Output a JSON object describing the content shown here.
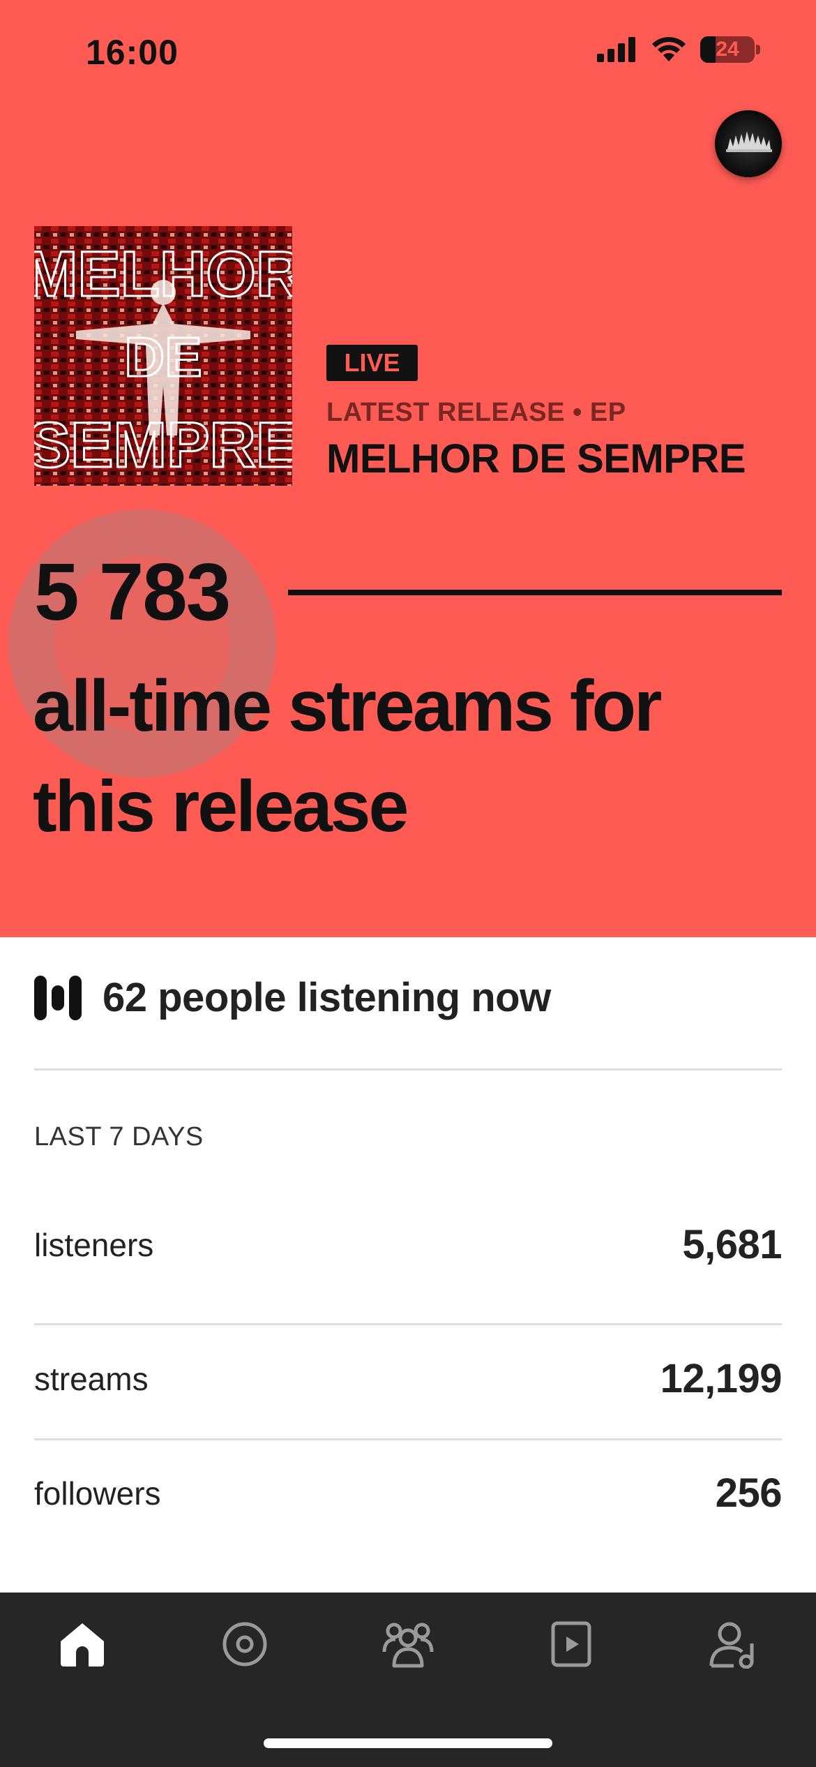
{
  "status_bar": {
    "time": "16:00",
    "battery": "24"
  },
  "release": {
    "badge": "LIVE",
    "label": "LATEST RELEASE • EP",
    "title": "MELHOR DE SEMPRE",
    "cover_text_lines": [
      "MELHOR",
      "DE",
      "SEMPRE"
    ]
  },
  "streams": {
    "count": "5 783",
    "caption": "all-time streams for this release"
  },
  "listening_now": {
    "text": "62 people listening now"
  },
  "last7": {
    "label": "LAST 7 DAYS",
    "rows": [
      {
        "label": "listeners",
        "value": "5,681"
      },
      {
        "label": "streams",
        "value": "12,199"
      },
      {
        "label": "followers",
        "value": "256"
      }
    ]
  },
  "tabs": [
    {
      "icon": "home-icon",
      "active": true
    },
    {
      "icon": "music-icon",
      "active": false
    },
    {
      "icon": "audience-icon",
      "active": false
    },
    {
      "icon": "video-icon",
      "active": false
    },
    {
      "icon": "profile-icon",
      "active": false
    }
  ],
  "colors": {
    "accent": "#fe5b54",
    "tabbar": "#262626",
    "text": "#121212"
  }
}
